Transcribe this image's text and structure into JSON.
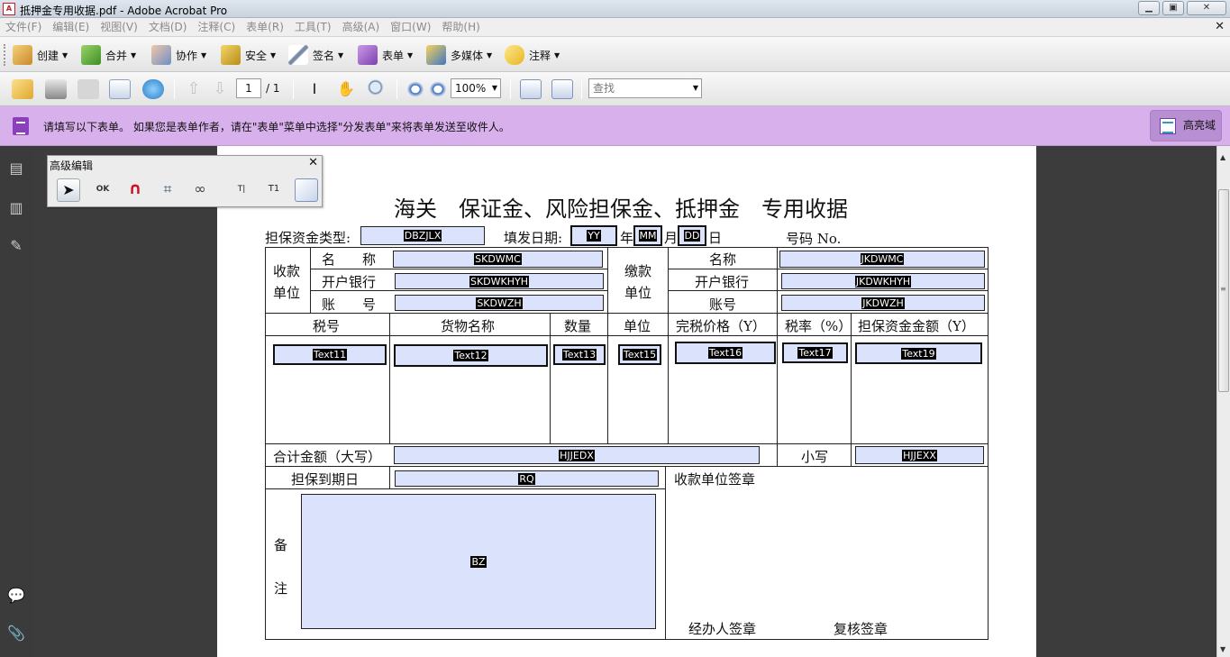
{
  "window": {
    "title": "抵押金专用收据.pdf - Adobe Acrobat Pro",
    "app_icon": "pdf-icon"
  },
  "menu": [
    "文件(F)",
    "编辑(E)",
    "视图(V)",
    "文档(D)",
    "注释(C)",
    "表单(R)",
    "工具(T)",
    "高级(A)",
    "窗口(W)",
    "帮助(H)"
  ],
  "toolbar": {
    "create": "创建",
    "combine": "合并",
    "collaborate": "协作",
    "secure": "安全",
    "sign": "签名",
    "forms": "表单",
    "multimedia": "多媒体",
    "comment": "注释"
  },
  "nav": {
    "page_current": "1",
    "page_total": "/ 1",
    "zoom": "100%",
    "find_placeholder": "查找"
  },
  "form_bar": {
    "message": "请填写以下表单。 如果您是表单作者，请在\"表单\"菜单中选择\"分发表单\"来将表单发送至收件人。",
    "highlight_label": "高亮域"
  },
  "adv_panel": {
    "title": "高级编辑"
  },
  "colors": {
    "form_bar": "#d8b0ec",
    "field_fill": "#dbe3fc",
    "left_panel": "#3b3b3b"
  },
  "doc": {
    "title": "海关　保证金、风险担保金、抵押金　专用收据",
    "guarantee_type_label": "担保资金类型:",
    "fill_date_label": "填发日期:",
    "year_label": "年",
    "month_label": "月",
    "day_label": "日",
    "number_label": "号码 No.",
    "payee_unit_a": "收款",
    "payee_unit_b": "单位",
    "payer_unit_a": "缴款",
    "payer_unit_b": "单位",
    "name_label_spaced": "名　　称",
    "bank_label": "开户银行",
    "account_label_spaced": "账　　号",
    "name_label": "名称",
    "bank_label2": "开户银行",
    "account_label": "账号",
    "col_tax_no": "税号",
    "col_goods": "货物名称",
    "col_qty": "数量",
    "col_unit": "单位",
    "col_dutiable": "完税价格（Y）",
    "col_rate": "税率（%）",
    "col_amount": "担保资金金额（Y）",
    "total_label": "合计金额（大写）",
    "small_label": "小写",
    "expiry_label": "担保到期日",
    "payee_seal": "收款单位签章",
    "remark_a": "备",
    "remark_b": "注",
    "handler_seal": "经办人签章",
    "reviewer_seal": "复核签章",
    "fields": {
      "type": "DBZJLX",
      "yy": "YY",
      "mm": "MM",
      "dd": "DD",
      "sk_name": "SKDWMC",
      "sk_bank": "SKDWKHYH",
      "sk_acct": "SKDWZH",
      "jk_name": "JKDWMC",
      "jk_bank": "JKDWKHYH",
      "jk_acct": "JKDWZH",
      "t11": "Text11",
      "t12": "Text12",
      "t13": "Text13",
      "t15": "Text15",
      "t16": "Text16",
      "t17": "Text17",
      "t19": "Text19",
      "total": "HJJEDX",
      "small": "HJJEXX",
      "rq": "RQ",
      "bz": "BZ"
    }
  }
}
